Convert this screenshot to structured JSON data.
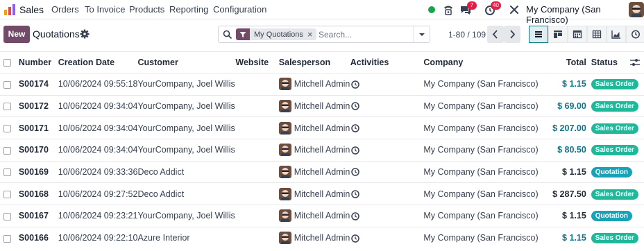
{
  "app": {
    "name": "Sales",
    "icon": "sales-app-icon"
  },
  "menu": [
    "Orders",
    "To Invoice",
    "Products",
    "Reporting",
    "Configuration"
  ],
  "systray": {
    "status_color": "#16a34a",
    "messages_count": "7",
    "activities_count": "40",
    "company": "My Company (San Francisco)"
  },
  "control": {
    "new_label": "New",
    "title": "Quotations",
    "facet_label": "My Quotations",
    "search_placeholder": "Search...",
    "pager": "1-80 / 109"
  },
  "views": [
    "list-view-icon",
    "kanban-view-icon",
    "calendar-view-icon",
    "pivot-view-icon",
    "graph-view-icon",
    "activity-view-icon"
  ],
  "columns": {
    "number": "Number",
    "creation_date": "Creation Date",
    "customer": "Customer",
    "website": "Website",
    "salesperson": "Salesperson",
    "activities": "Activities",
    "company": "Company",
    "total": "Total",
    "status": "Status"
  },
  "rows": [
    {
      "number": "S00174",
      "date": "10/06/2024 09:55:18",
      "customer": "YourCompany, Joel Willis",
      "website": "",
      "salesperson": "Mitchell Admin",
      "company": "My Company (San Francisco)",
      "total": "$ 1.15",
      "total_style": "link",
      "status": "Sales Order",
      "status_color": "#21b799"
    },
    {
      "number": "S00172",
      "date": "10/06/2024 09:34:04",
      "customer": "YourCompany, Joel Willis",
      "website": "",
      "salesperson": "Mitchell Admin",
      "company": "My Company (San Francisco)",
      "total": "$ 69.00",
      "total_style": "link",
      "status": "Sales Order",
      "status_color": "#21b799"
    },
    {
      "number": "S00171",
      "date": "10/06/2024 09:34:04",
      "customer": "YourCompany, Joel Willis",
      "website": "",
      "salesperson": "Mitchell Admin",
      "company": "My Company (San Francisco)",
      "total": "$ 207.00",
      "total_style": "link",
      "status": "Sales Order",
      "status_color": "#21b799"
    },
    {
      "number": "S00170",
      "date": "10/06/2024 09:34:04",
      "customer": "YourCompany, Joel Willis",
      "website": "",
      "salesperson": "Mitchell Admin",
      "company": "My Company (San Francisco)",
      "total": "$ 80.50",
      "total_style": "link",
      "status": "Sales Order",
      "status_color": "#21b799"
    },
    {
      "number": "S00169",
      "date": "10/06/2024 09:33:36",
      "customer": "Deco Addict",
      "website": "",
      "salesperson": "Mitchell Admin",
      "company": "My Company (San Francisco)",
      "total": "$ 1.15",
      "total_style": "plain",
      "status": "Quotation",
      "status_color": "#17a2b8"
    },
    {
      "number": "S00168",
      "date": "10/06/2024 09:27:52",
      "customer": "Deco Addict",
      "website": "",
      "salesperson": "Mitchell Admin",
      "company": "My Company (San Francisco)",
      "total": "$ 287.50",
      "total_style": "plain",
      "status": "Sales Order",
      "status_color": "#21b799"
    },
    {
      "number": "S00167",
      "date": "10/06/2024 09:23:21",
      "customer": "YourCompany, Joel Willis",
      "website": "",
      "salesperson": "Mitchell Admin",
      "company": "My Company (San Francisco)",
      "total": "$ 1.15",
      "total_style": "plain",
      "status": "Quotation",
      "status_color": "#17a2b8"
    },
    {
      "number": "S00166",
      "date": "10/06/2024 09:22:10",
      "customer": "Azure Interior",
      "website": "",
      "salesperson": "Mitchell Admin",
      "company": "My Company (San Francisco)",
      "total": "$ 1.15",
      "total_style": "link",
      "status": "Sales Order",
      "status_color": "#21b799"
    }
  ]
}
